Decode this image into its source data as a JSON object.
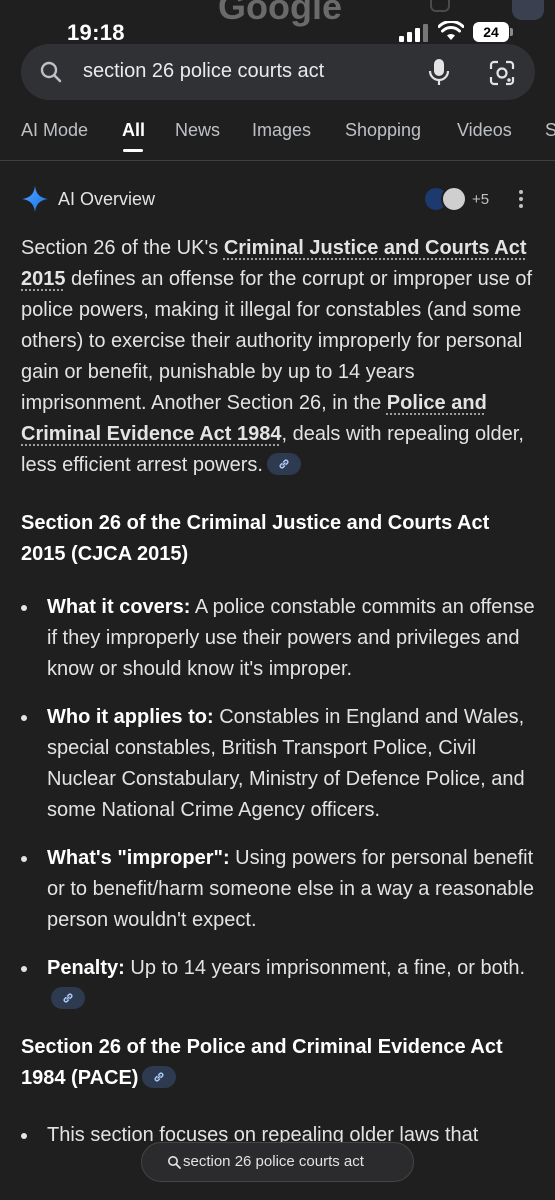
{
  "status": {
    "time": "19:18",
    "battery": "24",
    "ghost_logo": "Google"
  },
  "search": {
    "query": "section 26 police courts act"
  },
  "tabs": [
    "AI Mode",
    "All",
    "News",
    "Images",
    "Shopping",
    "Videos",
    "S"
  ],
  "ai_overview": {
    "title": "AI Overview",
    "sources_extra": "+5",
    "p1": {
      "t1": "Section 26 of the UK's ",
      "link1": "Criminal Justice and Courts Act 2015",
      "t2": " defines an offense for the corrupt or improper use of police powers, making it illegal for constables (and some others) to exercise their authority improperly for personal gain or benefit, punishable by up to 14 years imprisonment. Another Section 26, in the ",
      "link2": "Police and Criminal Evidence Act 1984",
      "t3": ", deals with repealing older, less efficient arrest powers."
    },
    "heading1": "Section 26 of the Criminal Justice and Courts Act 2015 (CJCA 2015)",
    "bullets": [
      {
        "label": "What it covers:",
        "text": " A police constable commits an offense if they improperly use their powers and privileges and know or should know it's improper."
      },
      {
        "label": "Who it applies to:",
        "text": " Constables in England and Wales, special constables, British Transport Police, Civil Nuclear Constabulary, Ministry of Defence Police, and some National Crime Agency officers."
      },
      {
        "label": "What's \"improper\":",
        "text": " Using powers for personal benefit or to benefit/harm someone else in a way a reasonable person wouldn't expect."
      },
      {
        "label": "Penalty:",
        "text": " Up to 14 years imprisonment, a fine, or both."
      }
    ],
    "heading2": "Section 26 of the Police and Criminal Evidence Act 1984 (PACE)",
    "bullet_partial": "This section focuses on repealing older laws that"
  },
  "floating_pill": {
    "text": "section 26 police courts act"
  }
}
